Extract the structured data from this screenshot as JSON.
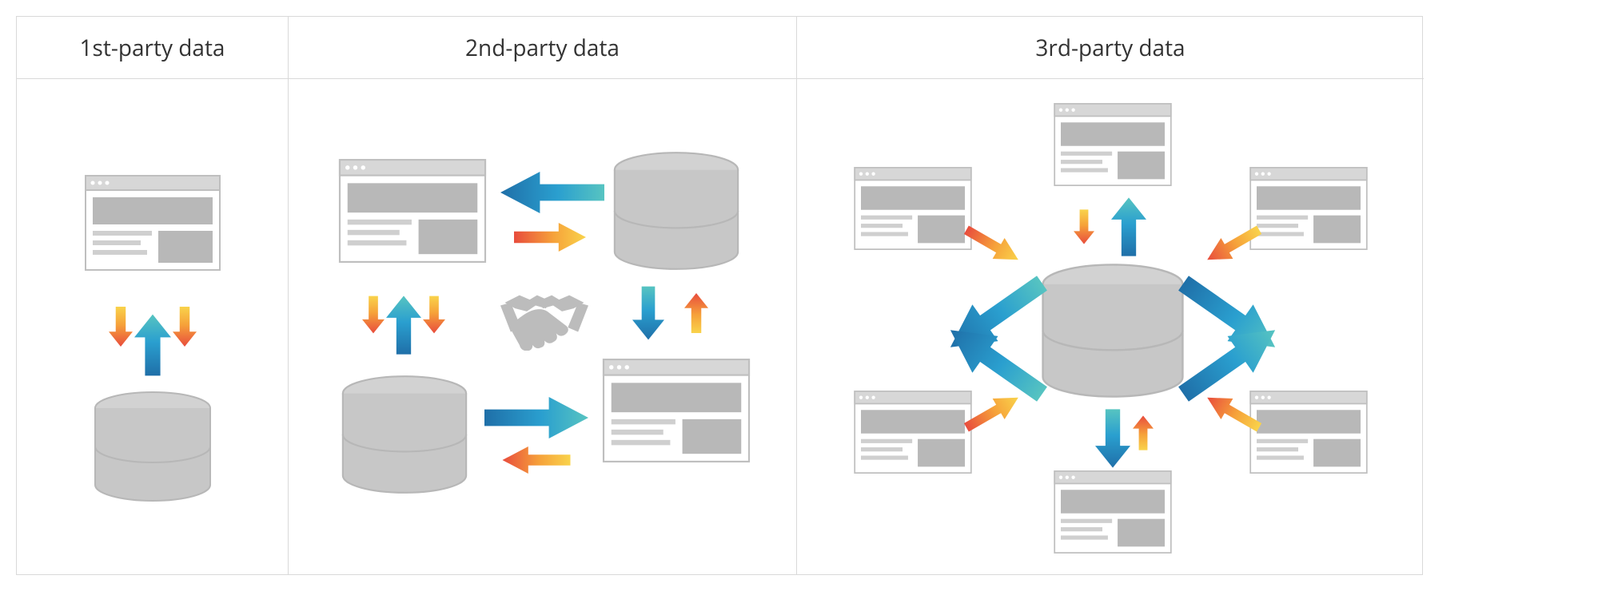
{
  "diagram": {
    "columns": [
      {
        "id": "first-party",
        "title": "1st-party data"
      },
      {
        "id": "second-party",
        "title": "2nd-party data"
      },
      {
        "id": "third-party",
        "title": "3rd-party data"
      }
    ],
    "icons": {
      "browser": "browser-window-icon",
      "database": "database-cylinder-icon",
      "handshake": "handshake-icon"
    },
    "arrows": {
      "warm_gradient": [
        "#e84c3d",
        "#f6a23a",
        "#f9d34b"
      ],
      "cool_gradient": [
        "#1f6fa8",
        "#2a9fcf",
        "#57c4c1"
      ]
    },
    "description": {
      "first_party": "A single website sends data to and retrieves data from its own database.",
      "second_party": "Two parties exchange data: each has a website and database, linked by a partnership (handshake).",
      "third_party": "A central database exchanges data with many independent websites around it."
    }
  }
}
